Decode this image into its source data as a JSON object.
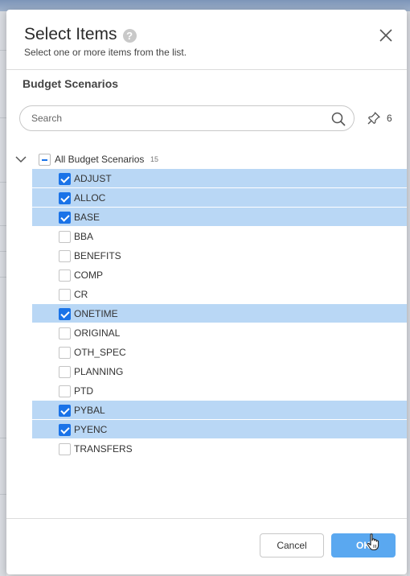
{
  "dialog": {
    "title": "Select Items",
    "help_icon": "question-icon",
    "subtitle": "Select one or more items from the list.",
    "close_icon": "close-icon"
  },
  "section": {
    "title": "Budget Scenarios"
  },
  "search": {
    "placeholder": "Search",
    "value": "",
    "icon": "search-icon"
  },
  "pinned": {
    "icon": "pin-icon",
    "count": "6"
  },
  "tree": {
    "root_label": "All Budget Scenarios",
    "root_count": "15",
    "root_state": "partial",
    "items": [
      {
        "label": "ADJUST",
        "checked": true
      },
      {
        "label": "ALLOC",
        "checked": true
      },
      {
        "label": "BASE",
        "checked": true
      },
      {
        "label": "BBA",
        "checked": false
      },
      {
        "label": "BENEFITS",
        "checked": false
      },
      {
        "label": "COMP",
        "checked": false
      },
      {
        "label": "CR",
        "checked": false
      },
      {
        "label": "ONETIME",
        "checked": true
      },
      {
        "label": "ORIGINAL",
        "checked": false
      },
      {
        "label": "OTH_SPEC",
        "checked": false
      },
      {
        "label": "PLANNING",
        "checked": false
      },
      {
        "label": "PTD",
        "checked": false
      },
      {
        "label": "PYBAL",
        "checked": true
      },
      {
        "label": "PYENC",
        "checked": true
      },
      {
        "label": "TRANSFERS",
        "checked": false
      }
    ]
  },
  "footer": {
    "cancel_label": "Cancel",
    "ok_label": "OK"
  },
  "colors": {
    "accent": "#1a73e8",
    "selected_row": "#b9d7f5",
    "ok_button": "#5aa8f0"
  }
}
